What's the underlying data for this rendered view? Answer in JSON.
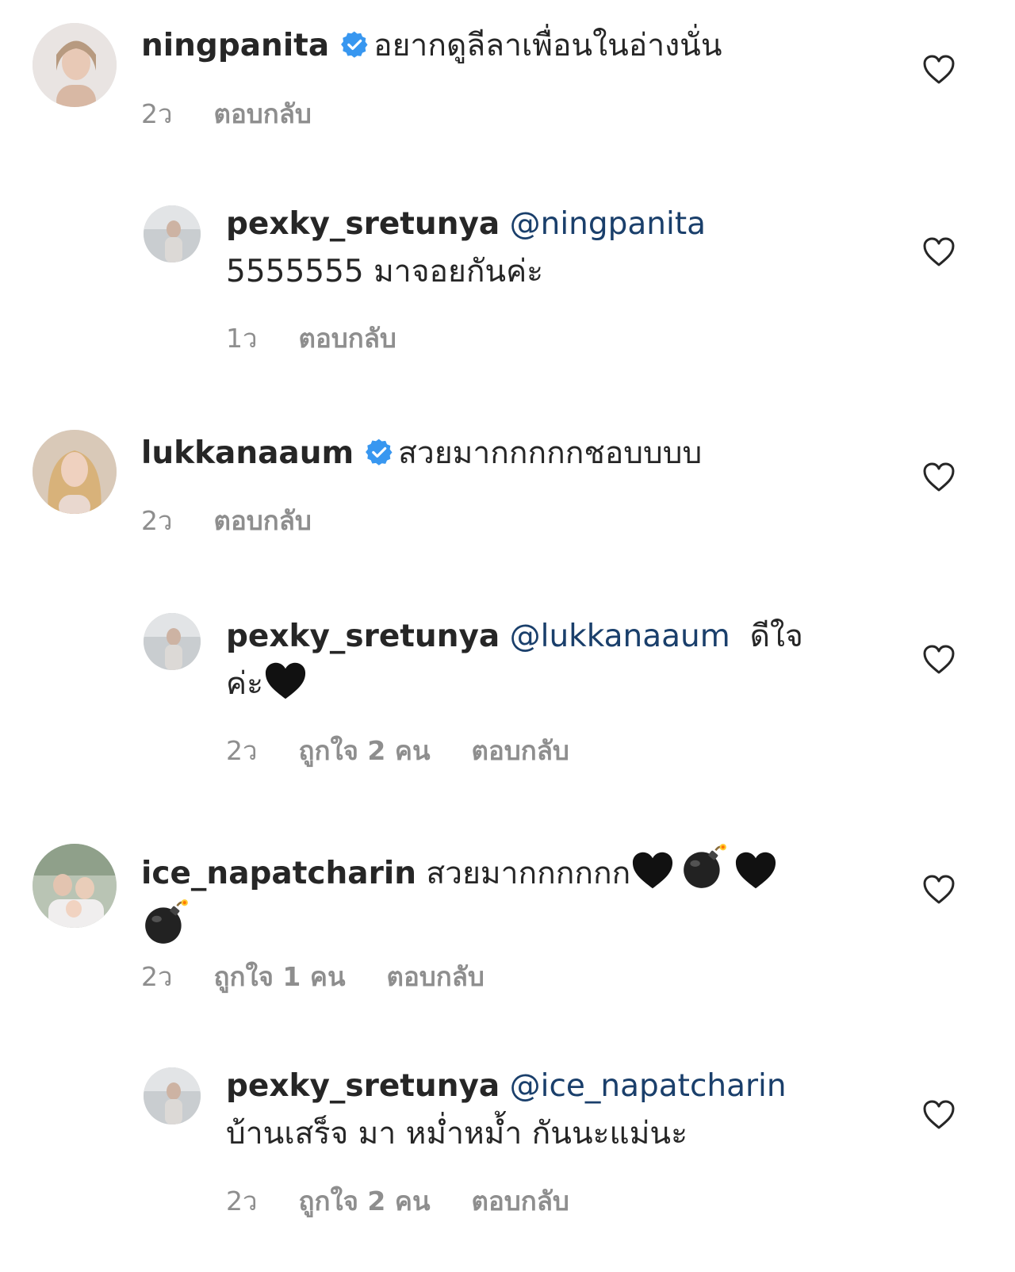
{
  "comments": [
    {
      "user": "ningpanita",
      "verified": true,
      "text": "อยากดูลีลาเพื่อนในอ่างนั่น",
      "time": "2ว",
      "reply_label": "ตอบกลับ"
    },
    {
      "user": "pexky_sretunya",
      "mention": "@ningpanita",
      "text": "5555555 มาจอยกันค่ะ",
      "time": "1ว",
      "reply_label": "ตอบกลับ"
    },
    {
      "user": "lukkanaaum",
      "verified": true,
      "text": "สวยมากกกกกชอบบบบ",
      "time": "2ว",
      "reply_label": "ตอบกลับ"
    },
    {
      "user": "pexky_sretunya",
      "mention": "@lukkanaaum",
      "text_a": "ดีใจ",
      "text_b": "ค่ะ",
      "time": "2ว",
      "likes": "ถูกใจ 2 คน",
      "reply_label": "ตอบกลับ"
    },
    {
      "user": "ice_napatcharin",
      "text": "สวยมากกกกกก",
      "time": "2ว",
      "likes": "ถูกใจ 1 คน",
      "reply_label": "ตอบกลับ"
    },
    {
      "user": "pexky_sretunya",
      "mention": "@ice_napatcharin",
      "text": "บ้านเสร็จ มา หม่ำหม้ำ กันนะแม่นะ",
      "time": "2ว",
      "likes": "ถูกใจ 2 คน",
      "reply_label": "ตอบกลับ"
    }
  ],
  "colors": {
    "text": "#262626",
    "meta": "#8e8e8e",
    "mention": "#1a3f6b",
    "verified": "#3897f0"
  },
  "icons": [
    "heart-icon",
    "verified-badge-icon",
    "black-heart-emoji",
    "bomb-emoji"
  ]
}
